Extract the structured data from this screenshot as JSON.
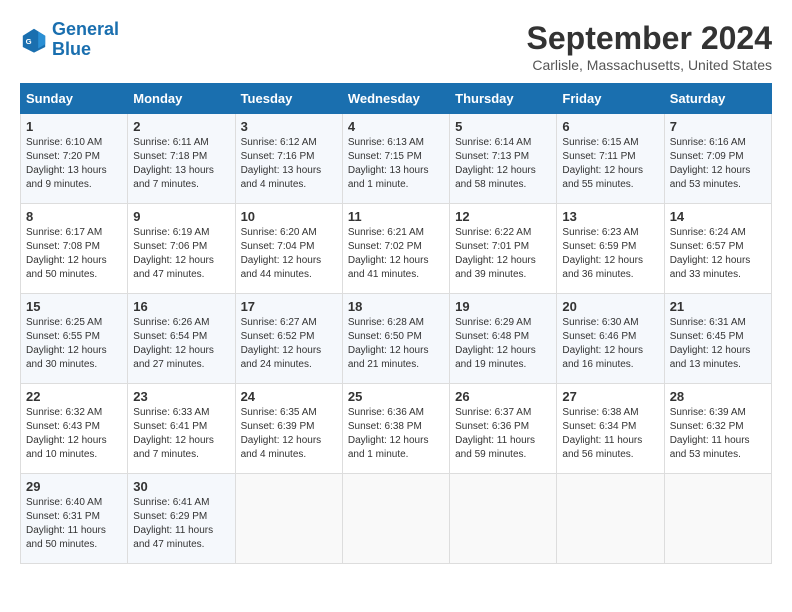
{
  "header": {
    "logo_line1": "General",
    "logo_line2": "Blue",
    "title": "September 2024",
    "location": "Carlisle, Massachusetts, United States"
  },
  "days_of_week": [
    "Sunday",
    "Monday",
    "Tuesday",
    "Wednesday",
    "Thursday",
    "Friday",
    "Saturday"
  ],
  "weeks": [
    [
      {
        "day": "1",
        "sunrise": "6:10 AM",
        "sunset": "7:20 PM",
        "daylight": "13 hours and 9 minutes."
      },
      {
        "day": "2",
        "sunrise": "6:11 AM",
        "sunset": "7:18 PM",
        "daylight": "13 hours and 7 minutes."
      },
      {
        "day": "3",
        "sunrise": "6:12 AM",
        "sunset": "7:16 PM",
        "daylight": "13 hours and 4 minutes."
      },
      {
        "day": "4",
        "sunrise": "6:13 AM",
        "sunset": "7:15 PM",
        "daylight": "13 hours and 1 minute."
      },
      {
        "day": "5",
        "sunrise": "6:14 AM",
        "sunset": "7:13 PM",
        "daylight": "12 hours and 58 minutes."
      },
      {
        "day": "6",
        "sunrise": "6:15 AM",
        "sunset": "7:11 PM",
        "daylight": "12 hours and 55 minutes."
      },
      {
        "day": "7",
        "sunrise": "6:16 AM",
        "sunset": "7:09 PM",
        "daylight": "12 hours and 53 minutes."
      }
    ],
    [
      {
        "day": "8",
        "sunrise": "6:17 AM",
        "sunset": "7:08 PM",
        "daylight": "12 hours and 50 minutes."
      },
      {
        "day": "9",
        "sunrise": "6:19 AM",
        "sunset": "7:06 PM",
        "daylight": "12 hours and 47 minutes."
      },
      {
        "day": "10",
        "sunrise": "6:20 AM",
        "sunset": "7:04 PM",
        "daylight": "12 hours and 44 minutes."
      },
      {
        "day": "11",
        "sunrise": "6:21 AM",
        "sunset": "7:02 PM",
        "daylight": "12 hours and 41 minutes."
      },
      {
        "day": "12",
        "sunrise": "6:22 AM",
        "sunset": "7:01 PM",
        "daylight": "12 hours and 39 minutes."
      },
      {
        "day": "13",
        "sunrise": "6:23 AM",
        "sunset": "6:59 PM",
        "daylight": "12 hours and 36 minutes."
      },
      {
        "day": "14",
        "sunrise": "6:24 AM",
        "sunset": "6:57 PM",
        "daylight": "12 hours and 33 minutes."
      }
    ],
    [
      {
        "day": "15",
        "sunrise": "6:25 AM",
        "sunset": "6:55 PM",
        "daylight": "12 hours and 30 minutes."
      },
      {
        "day": "16",
        "sunrise": "6:26 AM",
        "sunset": "6:54 PM",
        "daylight": "12 hours and 27 minutes."
      },
      {
        "day": "17",
        "sunrise": "6:27 AM",
        "sunset": "6:52 PM",
        "daylight": "12 hours and 24 minutes."
      },
      {
        "day": "18",
        "sunrise": "6:28 AM",
        "sunset": "6:50 PM",
        "daylight": "12 hours and 21 minutes."
      },
      {
        "day": "19",
        "sunrise": "6:29 AM",
        "sunset": "6:48 PM",
        "daylight": "12 hours and 19 minutes."
      },
      {
        "day": "20",
        "sunrise": "6:30 AM",
        "sunset": "6:46 PM",
        "daylight": "12 hours and 16 minutes."
      },
      {
        "day": "21",
        "sunrise": "6:31 AM",
        "sunset": "6:45 PM",
        "daylight": "12 hours and 13 minutes."
      }
    ],
    [
      {
        "day": "22",
        "sunrise": "6:32 AM",
        "sunset": "6:43 PM",
        "daylight": "12 hours and 10 minutes."
      },
      {
        "day": "23",
        "sunrise": "6:33 AM",
        "sunset": "6:41 PM",
        "daylight": "12 hours and 7 minutes."
      },
      {
        "day": "24",
        "sunrise": "6:35 AM",
        "sunset": "6:39 PM",
        "daylight": "12 hours and 4 minutes."
      },
      {
        "day": "25",
        "sunrise": "6:36 AM",
        "sunset": "6:38 PM",
        "daylight": "12 hours and 1 minute."
      },
      {
        "day": "26",
        "sunrise": "6:37 AM",
        "sunset": "6:36 PM",
        "daylight": "11 hours and 59 minutes."
      },
      {
        "day": "27",
        "sunrise": "6:38 AM",
        "sunset": "6:34 PM",
        "daylight": "11 hours and 56 minutes."
      },
      {
        "day": "28",
        "sunrise": "6:39 AM",
        "sunset": "6:32 PM",
        "daylight": "11 hours and 53 minutes."
      }
    ],
    [
      {
        "day": "29",
        "sunrise": "6:40 AM",
        "sunset": "6:31 PM",
        "daylight": "11 hours and 50 minutes."
      },
      {
        "day": "30",
        "sunrise": "6:41 AM",
        "sunset": "6:29 PM",
        "daylight": "11 hours and 47 minutes."
      },
      null,
      null,
      null,
      null,
      null
    ]
  ]
}
